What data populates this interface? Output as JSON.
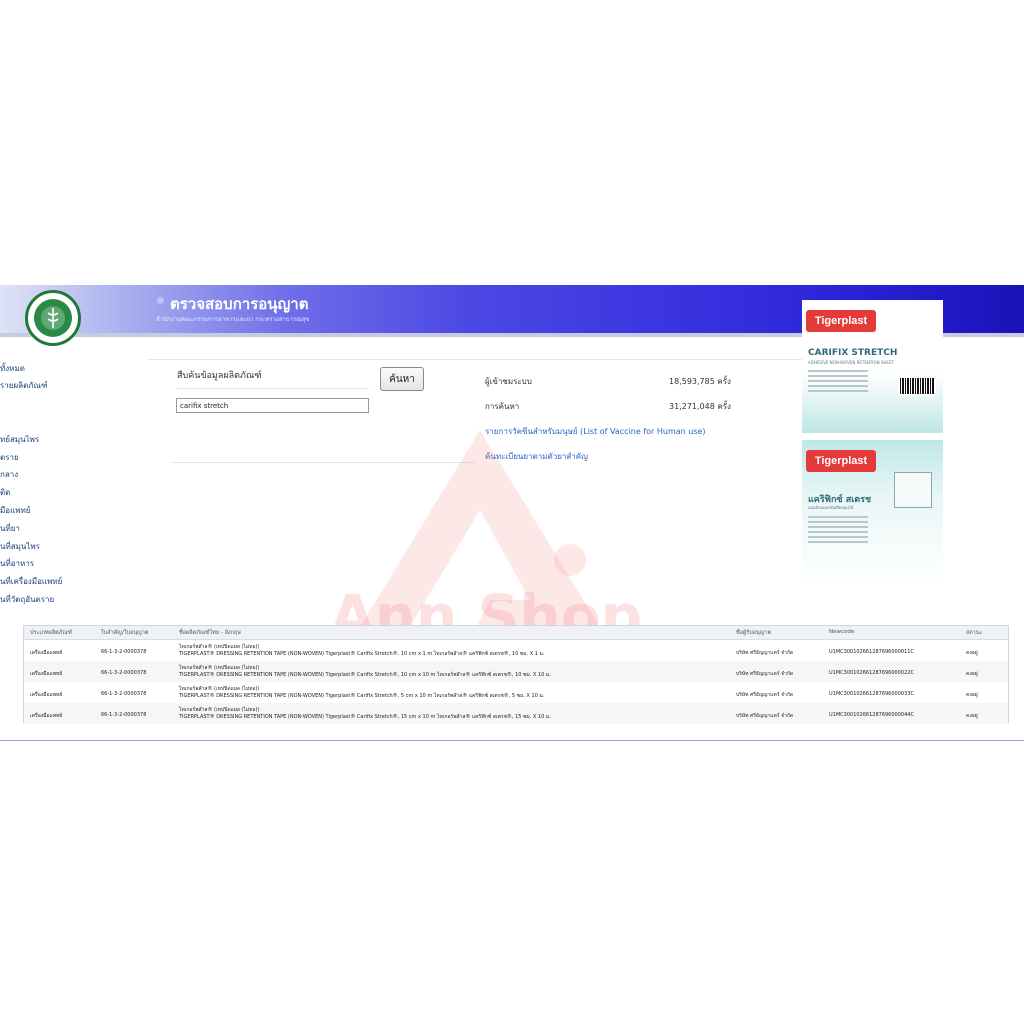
{
  "header": {
    "title": "ตรวจสอบการอนุญาต",
    "subtitle": "สำนักงานคณะกรรมการอาหารและยา กระทรวงสาธารณสุข",
    "logo_text": "MINISTRY OF PUBLIC HEALTH"
  },
  "sidebar": {
    "items": [
      "ทั้งหมด",
      "รายผลิตภัณฑ์",
      "ทย์สมุนไพร",
      "ตราย",
      "กลาง",
      "ติด",
      "มือแพทย์",
      "นที่ยา",
      "นที่สมุนไพร",
      "นที่อาหาร",
      "นที่เครื่องมือแพทย์",
      "นที่วัตถุอันตราย"
    ]
  },
  "search": {
    "label": "สืบค้นข้อมูลผลิตภัณฑ์",
    "value": "carifix stretch",
    "button_label": "ค้นหา"
  },
  "stats": {
    "visitors_label": "ผู้เข้าชมระบบ",
    "visitors_value": "18,593,785 ครั้ง",
    "searches_label": "การค้นหา",
    "searches_value": "31,271,048 ครั้ง"
  },
  "links": {
    "vaccine": "รายการวัคซีนสำหรับมนุษย์ (List of Vaccine for Human use)",
    "drug_search": "ค้นทะเบียนยาตามตัวยาสำคัญ"
  },
  "watermark": {
    "text": "Ann Shop"
  },
  "products": {
    "brand": "Tigerplast",
    "top_name": "CARIFIX STRETCH",
    "top_sub": "ADHESIVE NON-WOVEN RETENTION SHEET",
    "bottom_name": "แคริฟิกซ์ สเตรช",
    "bottom_sub": "แผ่นปิดแผลชนิดยืดหยุ่นได้"
  },
  "table": {
    "columns": [
      "ประเภทผลิตภัณฑ์",
      "ใบสำคัญ/ใบอนุญาต",
      "ชื่อผลิตภัณฑ์ไทย - อังกฤษ",
      "ชื่อผู้รับอนุญาต",
      "Newcode",
      "สถานะ"
    ],
    "rows": [
      {
        "type": "เครื่องมือแพทย์",
        "license": "66-1-3-2-0000378",
        "name_th": "ไทเกอร์พล๊าส® (เทปปิดแผล (ไม่ทอ))",
        "name_detail": "TIGERPLAST® DRESSING RETENTION TAPE (NON-WOVEN) Tigerplast® Carifix Stretch®, 10 cm x 1 m ไทเกอร์พล๊าส® แคริฟิกซ์ สเตรช®, 10 ซม. X 1 ม.",
        "holder": "บริษัท ศรีธัญญาแคร์ จำกัด",
        "newcode": "U1MC300102661287696000011C",
        "status": "คงอยู่"
      },
      {
        "type": "เครื่องมือแพทย์",
        "license": "66-1-3-2-0000378",
        "name_th": "ไทเกอร์พล๊าส® (เทปปิดแผล (ไม่ทอ))",
        "name_detail": "TIGERPLAST® DRESSING RETENTION TAPE (NON-WOVEN) Tigerplast® Carifix Stretch®, 10 cm x 10 m ไทเกอร์พล๊าส® แคริฟิกซ์ สเตรช®, 10 ซม. X 10 ม.",
        "holder": "บริษัท ศรีธัญญาแคร์ จำกัด",
        "newcode": "U1MC300102661287696000022C",
        "status": "คงอยู่"
      },
      {
        "type": "เครื่องมือแพทย์",
        "license": "66-1-3-2-0000378",
        "name_th": "ไทเกอร์พล๊าส® (เทปปิดแผล (ไม่ทอ))",
        "name_detail": "TIGERPLAST® DRESSING RETENTION TAPE (NON-WOVEN) Tigerplast® Carifix Stretch®, 5 cm x 10 m ไทเกอร์พล๊าส® แคริฟิกซ์ สเตรช®, 5 ซม. X 10 ม.",
        "holder": "บริษัท ศรีธัญญาแคร์ จำกัด",
        "newcode": "U1MC300102661287696000033C",
        "status": "คงอยู่"
      },
      {
        "type": "เครื่องมือแพทย์",
        "license": "66-1-3-2-0000378",
        "name_th": "ไทเกอร์พล๊าส® (เทปปิดแผล (ไม่ทอ))",
        "name_detail": "TIGERPLAST® DRESSING RETENTION TAPE (NON-WOVEN) Tigerplast® Carifix Stretch®, 15 cm x 10 m ไทเกอร์พล๊าส® แคริฟิกซ์ สเตรช®, 15 ซม. X 10 ม.",
        "holder": "บริษัท ศรีธัญญาแคร์ จำกัด",
        "newcode": "U1MC300102661287696000044C",
        "status": "คงอยู่"
      }
    ]
  }
}
